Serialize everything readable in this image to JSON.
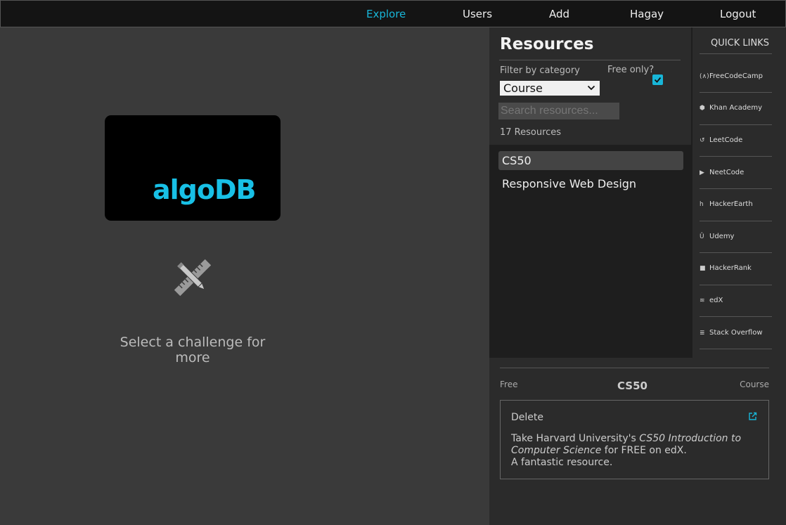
{
  "nav": {
    "explore": "Explore",
    "users": "Users",
    "add": "Add",
    "user": "Hagay",
    "logout": "Logout"
  },
  "main": {
    "logo_text": "algoDB",
    "hint": "Select a challenge for more"
  },
  "resources": {
    "title": "Resources",
    "filter_label": "Filter by category",
    "free_label": "Free only?",
    "free_checked": true,
    "category_selected": "Course",
    "search_placeholder": "Search resources...",
    "count": "17 Resources",
    "items": [
      {
        "label": "CS50",
        "selected": true
      },
      {
        "label": "Responsive Web Design",
        "selected": false
      }
    ]
  },
  "quick_links": {
    "title": "QUICK LINKS",
    "items": [
      {
        "label": "FreeCodeCamp",
        "icon": "freecodecamp-icon",
        "glyph": "(∧)"
      },
      {
        "label": "Khan Academy",
        "icon": "khan-academy-icon",
        "glyph": "⬢"
      },
      {
        "label": "LeetCode",
        "icon": "leetcode-icon",
        "glyph": "↺"
      },
      {
        "label": "NeetCode",
        "icon": "youtube-icon",
        "glyph": "▶"
      },
      {
        "label": "HackerEarth",
        "icon": "hackerearth-icon",
        "glyph": "h"
      },
      {
        "label": "Udemy",
        "icon": "udemy-icon",
        "glyph": "Û"
      },
      {
        "label": "HackerRank",
        "icon": "hackerrank-icon",
        "glyph": "■"
      },
      {
        "label": "edX",
        "icon": "edx-icon",
        "glyph": "≋"
      },
      {
        "label": "Stack Overflow",
        "icon": "stack-overflow-icon",
        "glyph": "≣"
      }
    ]
  },
  "detail": {
    "free": "Free",
    "name": "CS50",
    "category": "Course",
    "delete": "Delete",
    "desc_prefix": "Take Harvard University's ",
    "desc_italic": "CS50 Introduction to Computer Science",
    "desc_suffix": " for FREE on edX.",
    "desc_line2": "A fantastic resource."
  },
  "colors": {
    "accent": "#18b6d8",
    "logo": "#18c0e6",
    "nav_bg": "#141414",
    "panel_bg": "#2b2b2b"
  }
}
